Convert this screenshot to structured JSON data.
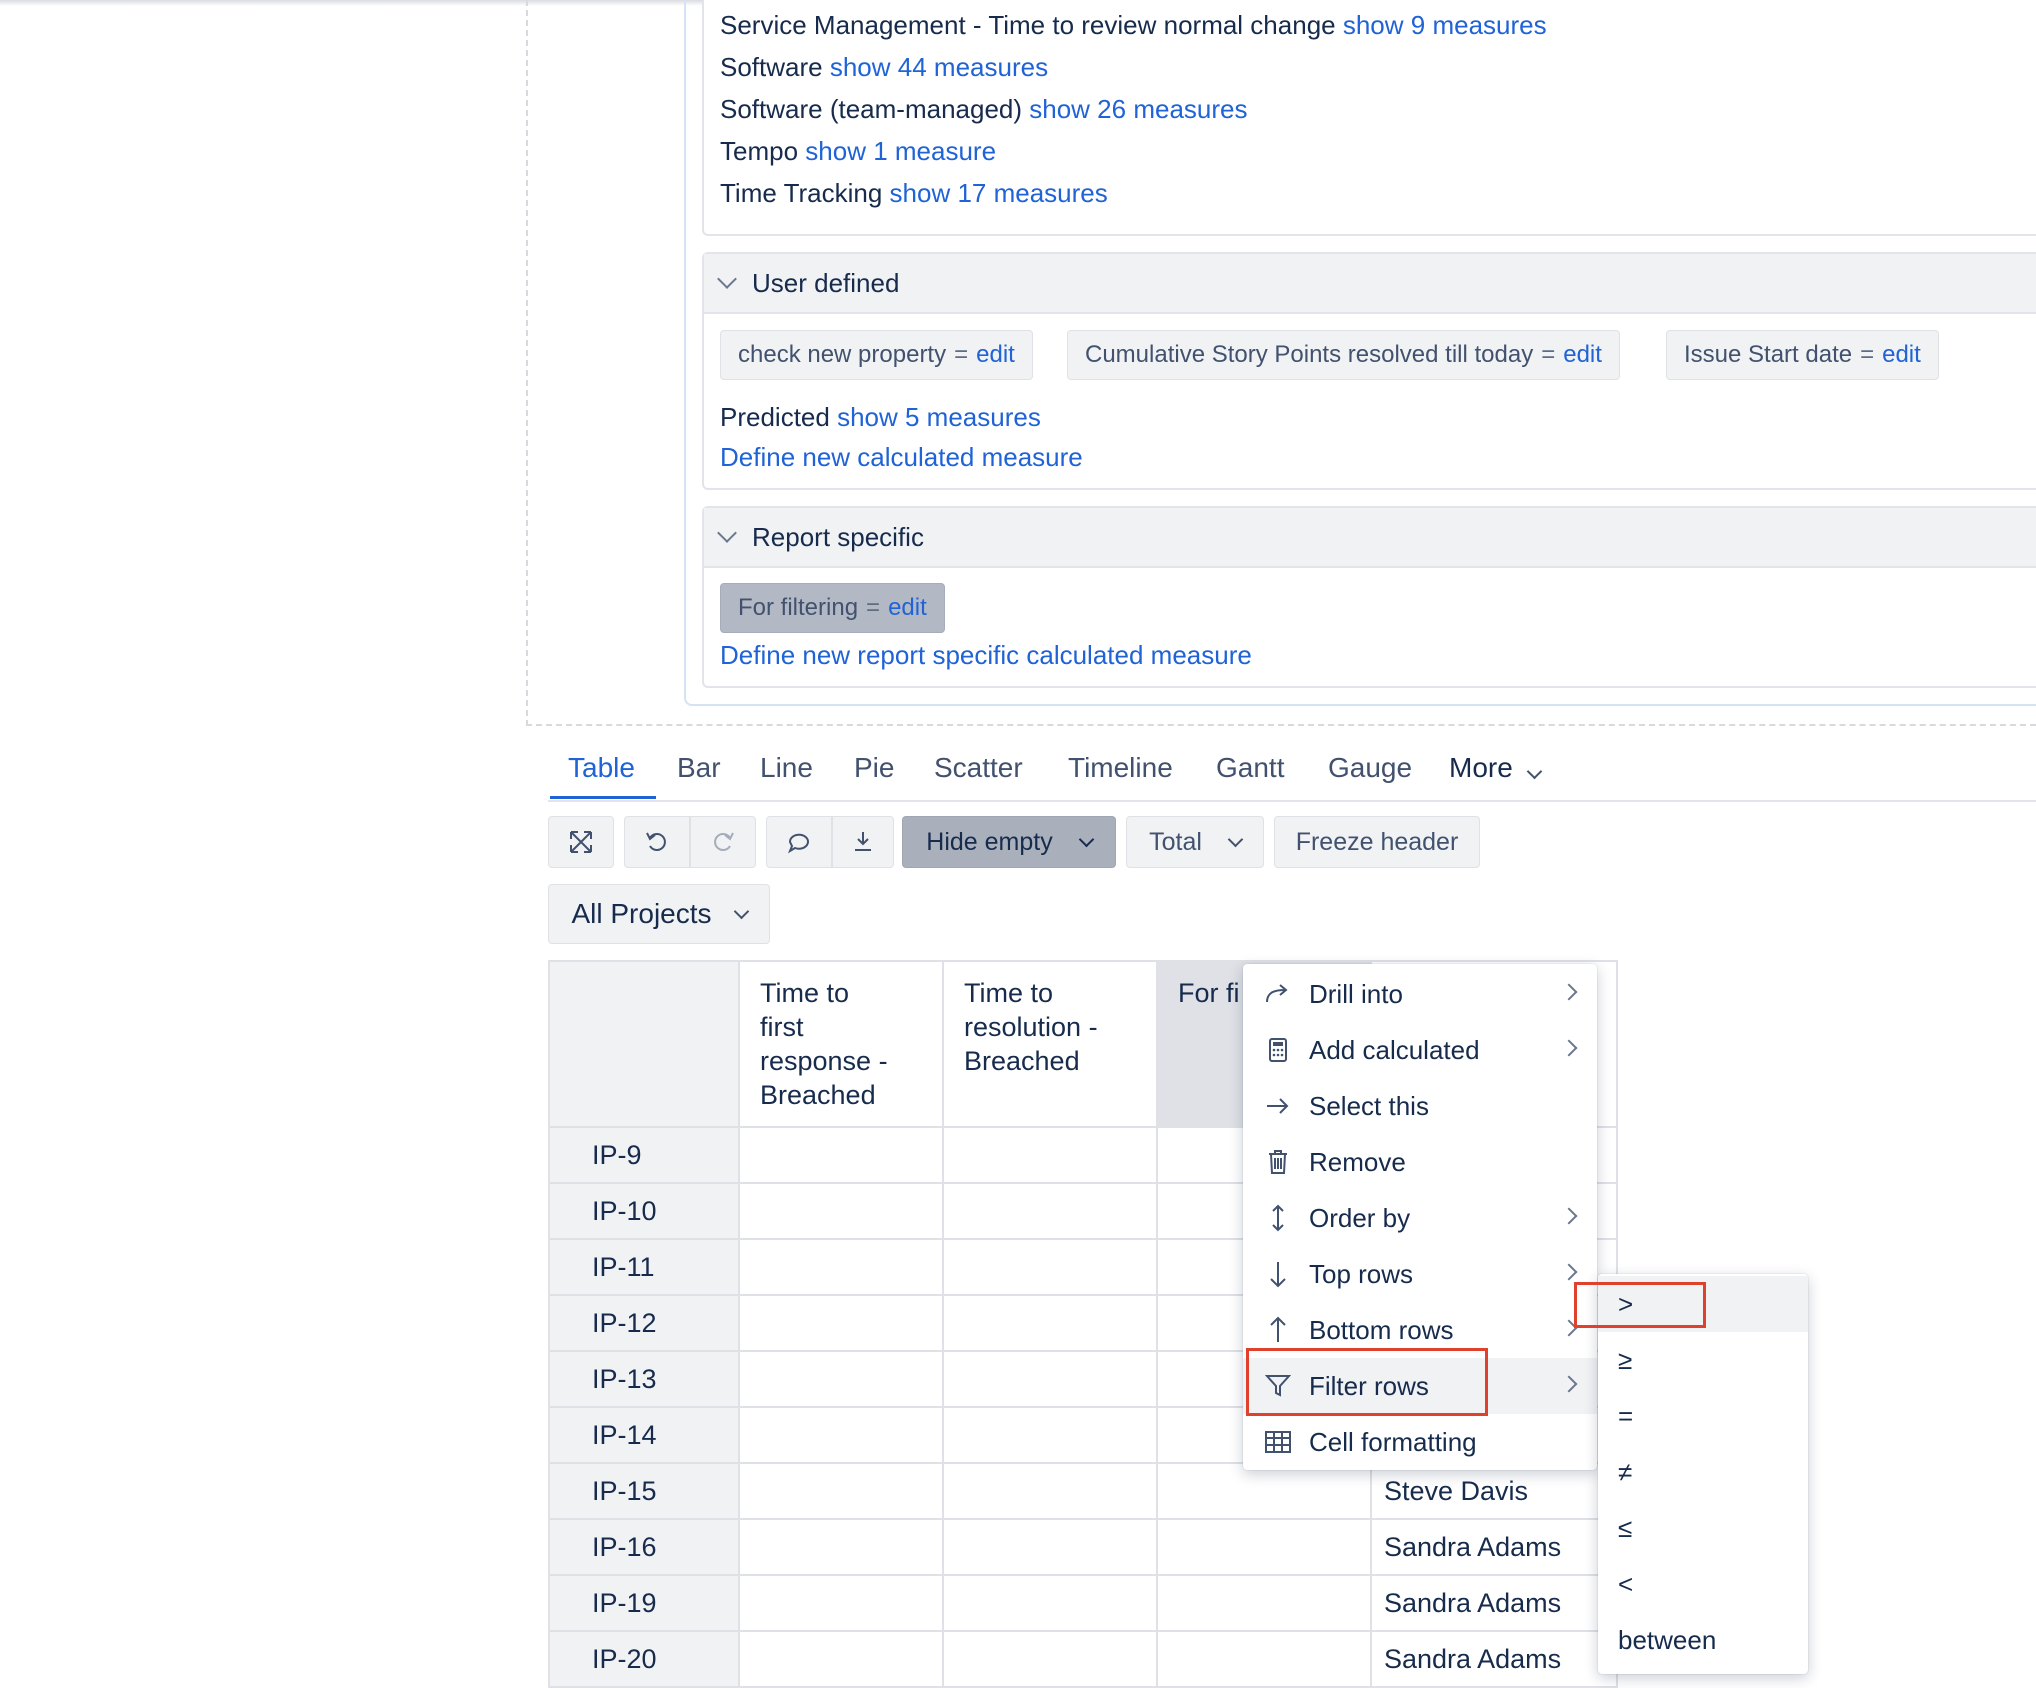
{
  "measures_list": [
    {
      "name": "Service Management - Time to review normal change",
      "link": "show 9 measures"
    },
    {
      "name": "Software",
      "link": "show 44 measures"
    },
    {
      "name": "Software (team-managed)",
      "link": "show 26 measures"
    },
    {
      "name": "Tempo",
      "link": "show 1 measure"
    },
    {
      "name": "Time Tracking",
      "link": "show 17 measures"
    }
  ],
  "user_defined": {
    "title": "User defined",
    "chips": [
      {
        "label": "check new property",
        "eq": "=",
        "edit": "edit"
      },
      {
        "label": "Cumulative Story Points resolved till today",
        "eq": "=",
        "edit": "edit"
      },
      {
        "label": "Issue Start date",
        "eq": "=",
        "edit": "edit"
      }
    ],
    "predicted": {
      "name": "Predicted",
      "link": "show 5 measures"
    },
    "define_link": "Define new calculated measure"
  },
  "report_specific": {
    "title": "Report specific",
    "chip": {
      "label": "For filtering",
      "eq": "=",
      "edit": "edit"
    },
    "define_link": "Define new report specific calculated measure"
  },
  "tabs": [
    "Table",
    "Bar",
    "Line",
    "Pie",
    "Scatter",
    "Timeline",
    "Gantt",
    "Gauge",
    "More"
  ],
  "active_tab": "Table",
  "toolbar": {
    "hide_empty": "Hide empty",
    "total": "Total",
    "freeze_header": "Freeze header"
  },
  "page_filter": "All Projects",
  "table": {
    "headers": [
      "Time to first response - Breached",
      "Time to resolution - Breached",
      "For fi"
    ],
    "header_lines_1": [
      "Time to",
      "first",
      "response -",
      "Breached"
    ],
    "header_lines_2": [
      "Time to",
      "resolution -",
      "Breached"
    ],
    "rows": [
      {
        "key": "IP-9",
        "assignee": ""
      },
      {
        "key": "IP-10",
        "assignee": ""
      },
      {
        "key": "IP-11",
        "assignee": ""
      },
      {
        "key": "IP-12",
        "assignee": ""
      },
      {
        "key": "IP-13",
        "assignee": ""
      },
      {
        "key": "IP-14",
        "assignee": ""
      },
      {
        "key": "IP-15",
        "assignee": "Steve Davis"
      },
      {
        "key": "IP-16",
        "assignee": "Sandra Adams"
      },
      {
        "key": "IP-19",
        "assignee": "Sandra Adams"
      },
      {
        "key": "IP-20",
        "assignee": "Sandra Adams"
      }
    ]
  },
  "context_menu": [
    {
      "label": "Drill into",
      "icon": "drill-into-icon",
      "submenu": true
    },
    {
      "label": "Add calculated",
      "icon": "calculator-icon",
      "submenu": true
    },
    {
      "label": "Select this",
      "icon": "arrow-right-icon",
      "submenu": false
    },
    {
      "label": "Remove",
      "icon": "trash-icon",
      "submenu": false
    },
    {
      "label": "Order by",
      "icon": "sort-icon",
      "submenu": true
    },
    {
      "label": "Top rows",
      "icon": "arrow-down-icon",
      "submenu": true
    },
    {
      "label": "Bottom rows",
      "icon": "arrow-up-icon",
      "submenu": true
    },
    {
      "label": "Filter rows",
      "icon": "filter-icon",
      "submenu": true
    },
    {
      "label": "Cell formatting",
      "icon": "table-icon",
      "submenu": false
    }
  ],
  "filter_submenu": [
    ">",
    "≥",
    "=",
    "≠",
    "≤",
    "<",
    "between"
  ]
}
